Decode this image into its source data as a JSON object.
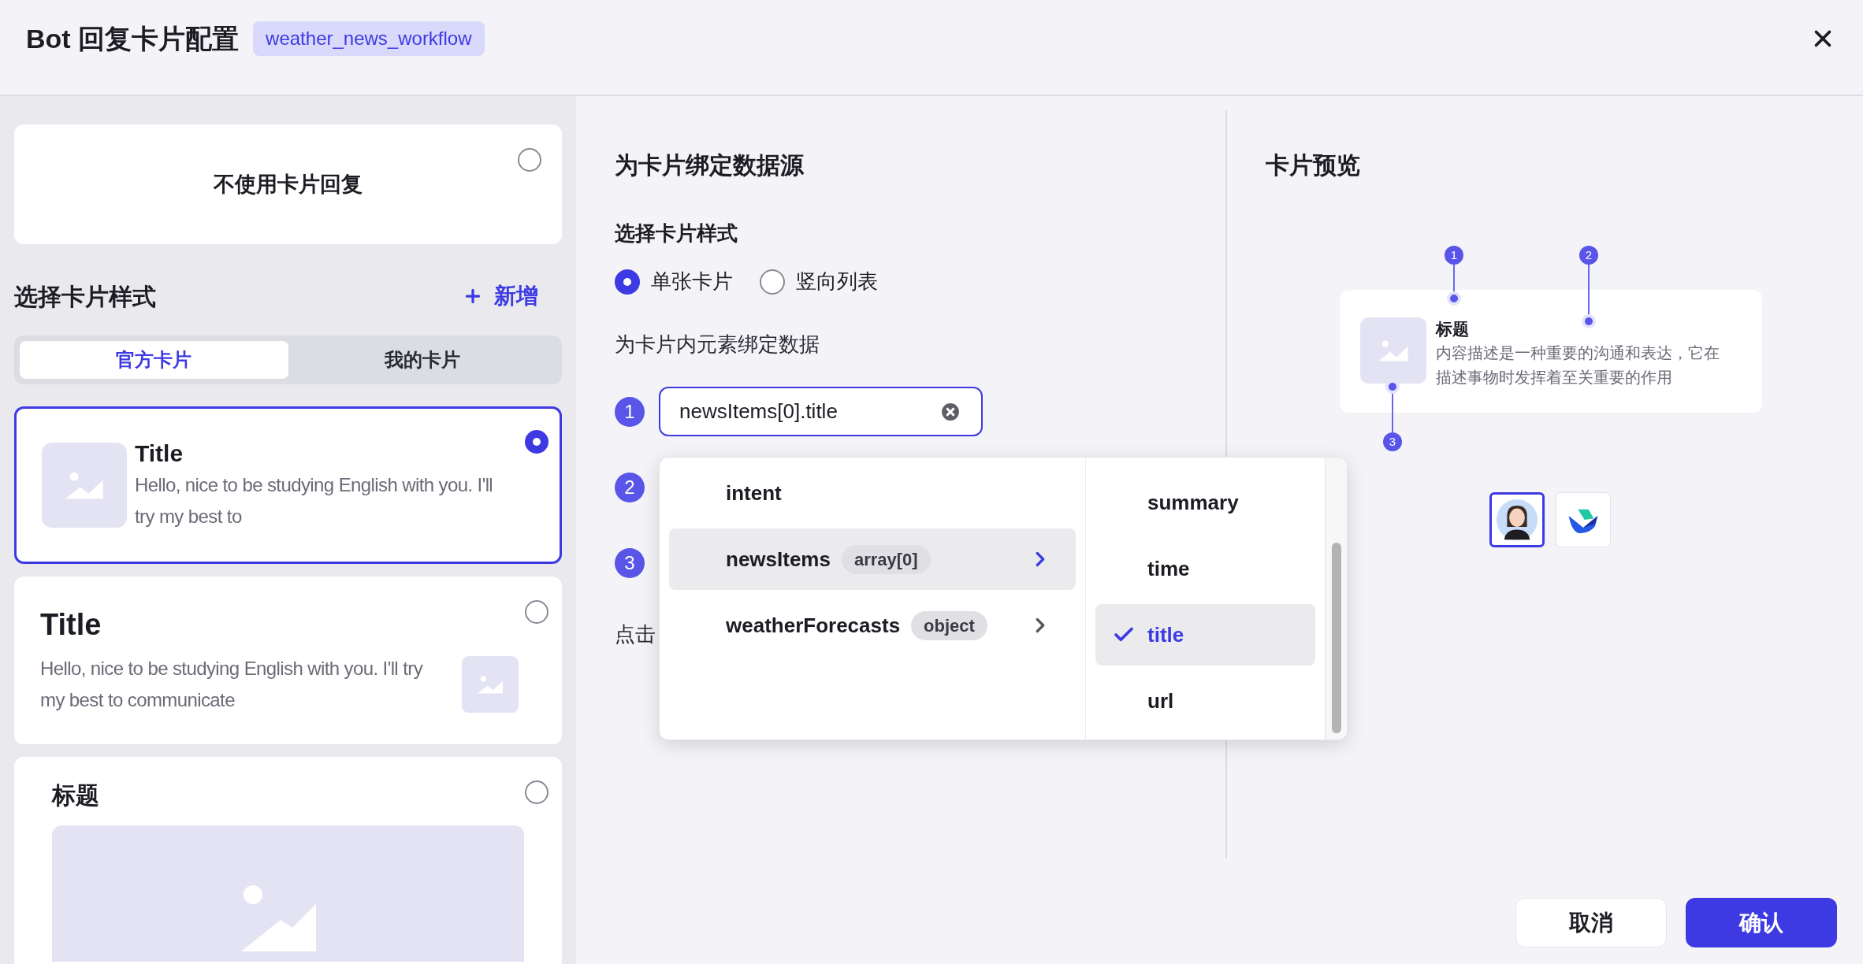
{
  "header": {
    "title": "Bot 回复卡片配置",
    "tag": "weather_news_workflow"
  },
  "left": {
    "no_card": {
      "label": "不使用卡片回复",
      "selected": false
    },
    "section_title": "选择卡片样式",
    "add_button": "新增",
    "tabs": [
      {
        "label": "官方卡片",
        "selected": true
      },
      {
        "label": "我的卡片",
        "selected": false
      }
    ],
    "cards": [
      {
        "kind": "image-left",
        "title": "Title",
        "text": "Hello, nice to be studying English with you. I'll try my best to",
        "selected": true
      },
      {
        "kind": "image-right",
        "title": "Title",
        "text": "Hello, nice to be studying English with you. I'll try my best to communicate",
        "selected": false
      },
      {
        "kind": "image-top",
        "title": "标题",
        "selected": false
      }
    ]
  },
  "binding": {
    "title": "为卡片绑定数据源",
    "style_label": "选择卡片样式",
    "styles": [
      {
        "label": "单张卡片",
        "selected": true
      },
      {
        "label": "竖向列表",
        "selected": false
      }
    ],
    "elements_label": "为卡片内元素绑定数据",
    "rows": [
      {
        "number": "1",
        "value": "newsItems[0].title"
      },
      {
        "number": "2"
      },
      {
        "number": "3"
      }
    ],
    "hint": "点击"
  },
  "dropdown": {
    "fields": [
      {
        "name": "intent",
        "selected": false
      },
      {
        "name": "newsItems",
        "type": "array[0]",
        "selected": true
      },
      {
        "name": "weatherForecasts",
        "type": "object",
        "selected": false
      }
    ],
    "subfields": [
      {
        "name": "summary",
        "selected": false
      },
      {
        "name": "time",
        "selected": false
      },
      {
        "name": "title",
        "selected": true
      },
      {
        "name": "url",
        "selected": false
      }
    ]
  },
  "preview": {
    "title": "卡片预览",
    "card": {
      "title": "标题",
      "text": "内容描述是一种重要的沟通和表达，它在描述事物时发挥着至关重要的作用"
    },
    "markers": [
      "1",
      "2",
      "3"
    ],
    "avatars": [
      {
        "kind": "person",
        "selected": true
      },
      {
        "kind": "logo",
        "selected": false
      }
    ]
  },
  "buttons": [
    {
      "label": "取消",
      "kind": "secondary"
    },
    {
      "label": "确认",
      "kind": "primary"
    }
  ]
}
